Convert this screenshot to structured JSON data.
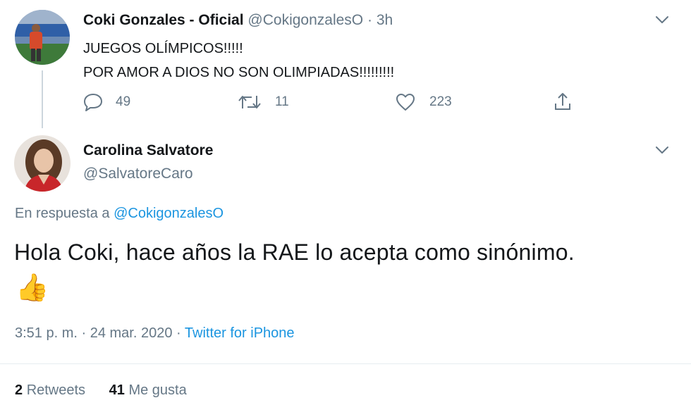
{
  "parent_tweet": {
    "display_name": "Coki Gonzales - Oficial",
    "handle": "@CokigonzalesO",
    "separator": "·",
    "time": "3h",
    "text_line1": "JUEGOS OLÍMPICOS!!!!!",
    "text_line2": "POR AMOR A DIOS NO SON OLIMPIADAS!!!!!!!!!",
    "stats": {
      "replies": "49",
      "retweets": "11",
      "likes": "223"
    }
  },
  "reply_tweet": {
    "display_name": "Carolina Salvatore",
    "handle": "@SalvatoreCaro",
    "reply_prefix": "En respuesta a",
    "reply_to": "@CokigonzalesO",
    "text": "Hola Coki, hace años la RAE lo acepta como sinónimo.",
    "emoji": "👍",
    "timestamp": "3:51 p. m. · 24 mar. 2020",
    "timestamp_sep": "·",
    "source": "Twitter for iPhone",
    "retweets_count": "2",
    "retweets_label": "Retweets",
    "likes_count": "41",
    "likes_label": "Me gusta"
  },
  "colors": {
    "link": "#1b95e0",
    "muted": "#657786",
    "text": "#14171a"
  }
}
